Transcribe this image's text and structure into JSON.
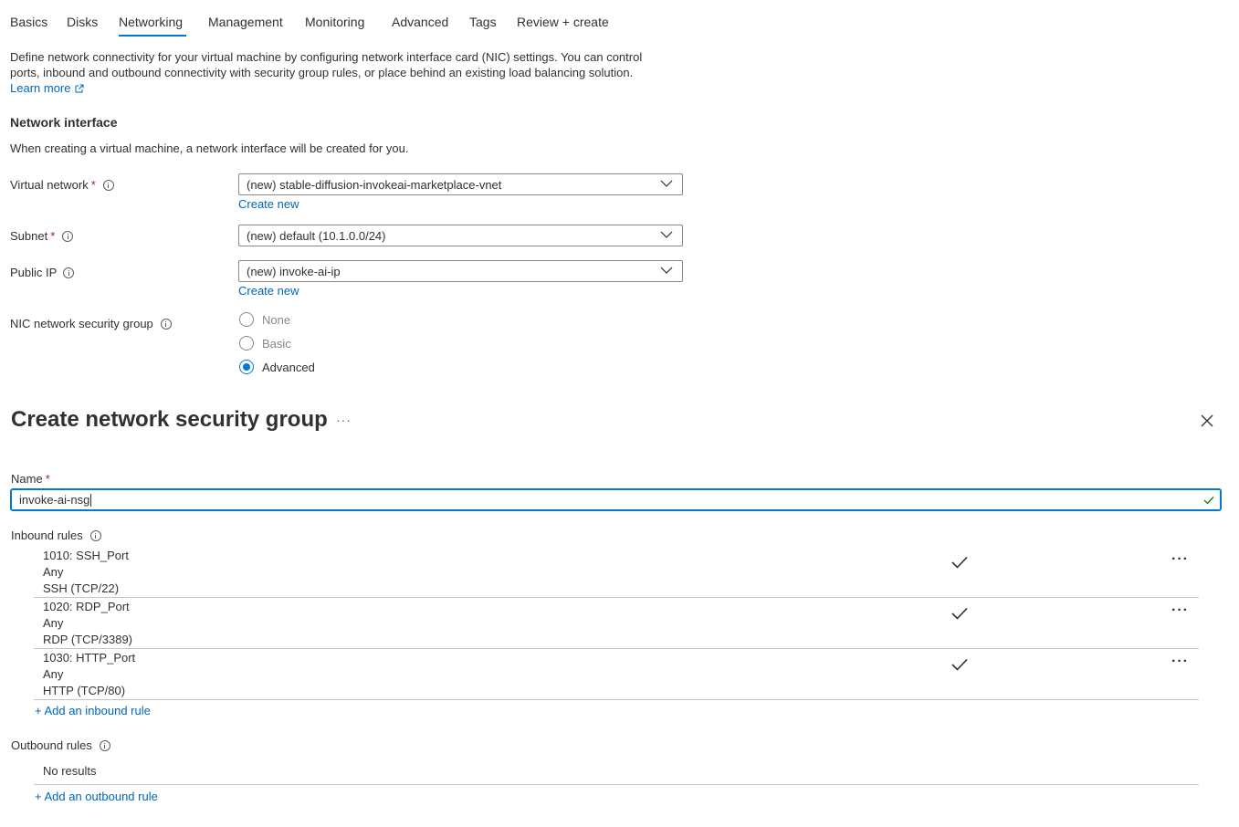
{
  "tabs": [
    {
      "label": "Basics"
    },
    {
      "label": "Disks"
    },
    {
      "label": "Networking"
    },
    {
      "label": "Management"
    },
    {
      "label": "Monitoring"
    },
    {
      "label": "Advanced"
    },
    {
      "label": "Tags"
    },
    {
      "label": "Review + create"
    }
  ],
  "active_tab": "Networking",
  "intro": {
    "line1": "Define network connectivity for your virtual machine by configuring network interface card (NIC) settings. You can control",
    "line2": "ports, inbound and outbound connectivity with security group rules, or place behind an existing load balancing solution.",
    "learn_more": "Learn more"
  },
  "network_interface": {
    "heading": "Network interface",
    "description": "When creating a virtual machine, a network interface will be created for you.",
    "virtual_network": {
      "label": "Virtual network",
      "value": "(new) stable-diffusion-invokeai-marketplace-vnet",
      "create_new": "Create new"
    },
    "subnet": {
      "label": "Subnet",
      "value": "(new) default (10.1.0.0/24)"
    },
    "public_ip": {
      "label": "Public IP",
      "value": "(new) invoke-ai-ip",
      "create_new": "Create new"
    },
    "nsg": {
      "label": "NIC network security group",
      "options": [
        "None",
        "Basic",
        "Advanced"
      ],
      "selected": "Advanced"
    },
    "required_mark": "*"
  },
  "panel": {
    "title": "Create network security group",
    "more": "···",
    "name_label": "Name",
    "name_value": "invoke-ai-nsg",
    "inbound_label": "Inbound rules",
    "inbound_rules": [
      {
        "title": "1010: SSH_Port",
        "source": "Any",
        "service": "SSH (TCP/22)"
      },
      {
        "title": "1020: RDP_Port",
        "source": "Any",
        "service": "RDP (TCP/3389)"
      },
      {
        "title": "1030: HTTP_Port",
        "source": "Any",
        "service": "HTTP (TCP/80)"
      }
    ],
    "add_inbound": "+ Add an inbound rule",
    "outbound_label": "Outbound rules",
    "outbound_empty": "No results",
    "add_outbound": "+ Add an outbound rule",
    "row_more": "···"
  },
  "colors": {
    "accent": "#0078d4",
    "link": "#0067b8",
    "required": "#a4262c",
    "valid": "#107c10"
  }
}
